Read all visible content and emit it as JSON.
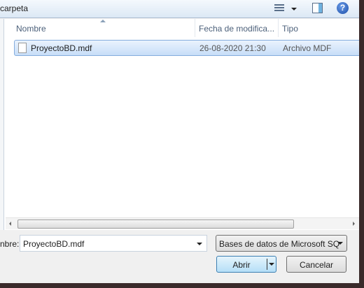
{
  "toolbar": {
    "location_label": "carpeta"
  },
  "columns": [
    {
      "label": "Nombre"
    },
    {
      "label": "Fecha de modifica..."
    },
    {
      "label": "Tipo"
    }
  ],
  "files": [
    {
      "name": "ProyectoBD.mdf",
      "date": "26-08-2020 21:30",
      "type": "Archivo MDF"
    }
  ],
  "footer": {
    "filename_label": "nbre:",
    "filename_value": "ProyectoBD.mdf",
    "filter": "Bases de datos de Microsoft SQ",
    "open_label": "Abrir",
    "cancel_label": "Cancelar"
  }
}
